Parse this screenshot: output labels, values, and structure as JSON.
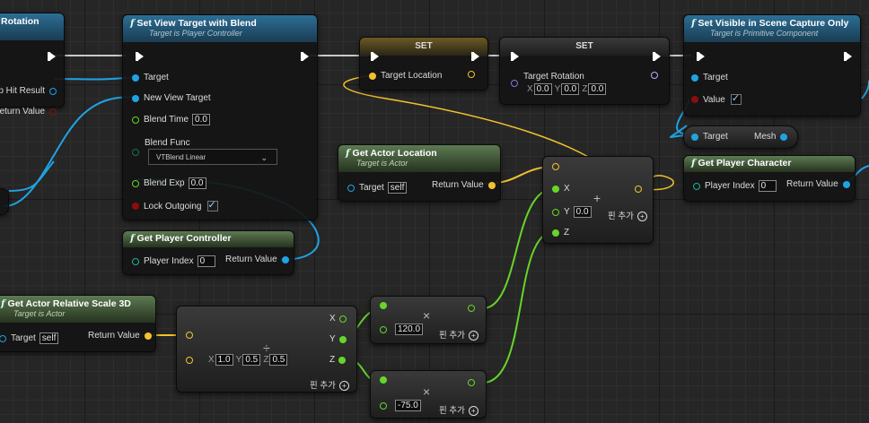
{
  "nodes": {
    "rotation_partial": {
      "title": "Rotation",
      "pins": [
        "p Hit Result",
        "eturn Value"
      ]
    },
    "set_view_target": {
      "title": "Set View Target with Blend",
      "subtitle": "Target is Player Controller",
      "target": "Target",
      "new_view_target": "New View Target",
      "blend_time_label": "Blend Time",
      "blend_time": "0.0",
      "blend_func_label": "Blend Func",
      "blend_func": "VTBlend Linear",
      "blend_exp_label": "Blend Exp",
      "blend_exp": "0.0",
      "lock_outgoing_label": "Lock Outgoing"
    },
    "set_location": {
      "title": "SET",
      "pin": "Target Location"
    },
    "set_rotation": {
      "title": "SET",
      "pin": "Target Rotation",
      "x": "0.0",
      "y": "0.0",
      "z": "0.0"
    },
    "set_visible": {
      "title": "Set Visible in Scene Capture Only",
      "subtitle": "Target is Primitive Component",
      "target": "Target",
      "value": "Value"
    },
    "mesh_getter": {
      "target": "Target",
      "output": "Mesh"
    },
    "get_player_character": {
      "title": "Get Player Character",
      "index_label": "Player Index",
      "index": "0",
      "output": "Return Value"
    },
    "get_actor_location": {
      "title": "Get Actor Location",
      "subtitle": "Target is Actor",
      "target": "Target",
      "self": "self",
      "output": "Return Value"
    },
    "make_vector_add": {
      "x": "X",
      "y": "Y",
      "y_val": "0.0",
      "z": "Z",
      "add_pin": "핀 추가",
      "op": "+"
    },
    "get_player_controller": {
      "title": "Get Player Controller",
      "index_label": "Player Index",
      "index": "0",
      "output": "Return Value"
    },
    "get_scale": {
      "title": "Get Actor Relative Scale 3D",
      "subtitle": "Target is Actor",
      "target": "Target",
      "self": "self",
      "output": "Return Value"
    },
    "divide": {
      "x_lbl": "X",
      "x": "1.0",
      "y_lbl": "Y",
      "y": "0.5",
      "z_lbl": "Z",
      "z": "0.5",
      "out_x": "X",
      "out_y": "Y",
      "out_z": "Z",
      "add_pin": "핀 추가",
      "op": "÷"
    },
    "mul1": {
      "value": "120.0",
      "add_pin": "핀 추가",
      "op": "×"
    },
    "mul2": {
      "value": "-75.0",
      "add_pin": "핀 추가",
      "op": "×"
    }
  },
  "colors": {
    "exec": "#ffffff",
    "object": "#1fa3e3",
    "vector": "#f2c12e",
    "float": "#67d52a",
    "bool": "#8c0d0d",
    "struct": "#2a3fc7",
    "byte": "#1d6e5a"
  }
}
